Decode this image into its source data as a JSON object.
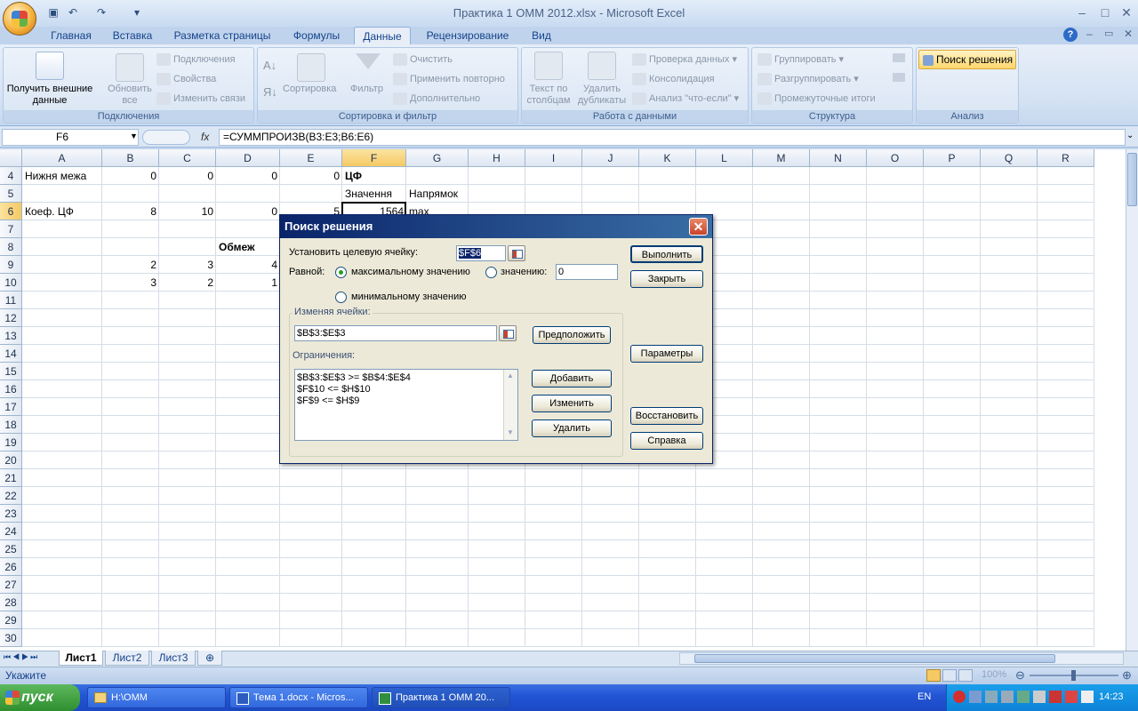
{
  "window": {
    "title": "Практика 1 ОММ 2012.xlsx - Microsoft Excel",
    "controls": {
      "minimize": "–",
      "maximize": "□",
      "close": "✕"
    }
  },
  "ribbon_tabs": [
    "Главная",
    "Вставка",
    "Разметка страницы",
    "Формулы",
    "Данные",
    "Рецензирование",
    "Вид"
  ],
  "active_tab": "Данные",
  "ribbon": {
    "connections_group": {
      "label": "Подключения",
      "get_external_data": "Получить внешние данные",
      "refresh_all": "Обновить все",
      "connections": "Подключения",
      "properties": "Свойства",
      "edit_links": "Изменить связи"
    },
    "sort_filter_group": {
      "label": "Сортировка и фильтр",
      "sort": "Сортировка",
      "filter": "Фильтр",
      "clear": "Очистить",
      "reapply": "Применить повторно",
      "advanced": "Дополнительно"
    },
    "data_tools_group": {
      "label": "Работа с данными",
      "text_to_columns": "Текст по столбцам",
      "remove_duplicates": "Удалить дубликаты",
      "data_validation": "Проверка данных",
      "consolidate": "Консолидация",
      "what_if": "Анализ \"что-если\""
    },
    "outline_group": {
      "label": "Структура",
      "group": "Группировать",
      "ungroup": "Разгруппировать",
      "subtotal": "Промежуточные итоги"
    },
    "analysis_group": {
      "label": "Анализ",
      "solver": "Поиск решения"
    }
  },
  "formula_bar": {
    "name_box": "F6",
    "fx": "fx",
    "formula": "=СУММПРОИЗВ(B3:E3;B6:E6)"
  },
  "columns": [
    "A",
    "B",
    "C",
    "D",
    "E",
    "F",
    "G",
    "H",
    "I",
    "J",
    "K",
    "L",
    "M",
    "N",
    "O",
    "P",
    "Q",
    "R"
  ],
  "rows": [
    "4",
    "5",
    "6",
    "7",
    "8",
    "9",
    "10",
    "11",
    "12",
    "13",
    "14",
    "15",
    "16",
    "17",
    "18",
    "19",
    "20",
    "21",
    "22",
    "23",
    "24",
    "25",
    "26",
    "27",
    "28",
    "29",
    "30"
  ],
  "cells": {
    "A4": "Нижня межа",
    "B4": "0",
    "C4": "0",
    "D4": "0",
    "E4": "0",
    "F4": "ЦФ",
    "F5": "Значення",
    "G5": "Напрямок",
    "A6": "Коеф. ЦФ",
    "B6": "8",
    "C6": "10",
    "D6": "0",
    "E6": "5",
    "F6": "1564",
    "G6": "max",
    "D8": "Обмеж",
    "B9": "2",
    "C9": "3",
    "D9": "4",
    "B10": "3",
    "C10": "2",
    "D10": "1"
  },
  "sheets": [
    "Лист1",
    "Лист2",
    "Лист3"
  ],
  "active_sheet": "Лист1",
  "status": {
    "mode": "Укажите",
    "zoom": "100%"
  },
  "solver_dialog": {
    "title": "Поиск решения",
    "target_label": "Установить целевую ячейку:",
    "target_value": "$F$6",
    "equal_label": "Равной:",
    "max_label": "максимальному значению",
    "value_label": "значению:",
    "value_input": "0",
    "min_label": "минимальному значению",
    "selected_option": "max",
    "changing_label": "Изменяя ячейки:",
    "changing_value": "$B$3:$E$3",
    "guess_button": "Предположить",
    "constraints_label": "Ограничения:",
    "constraints": [
      "$B$3:$E$3 >= $B$4:$E$4",
      "$F$10 <= $H$10",
      "$F$9 <= $H$9"
    ],
    "add_button": "Добавить",
    "change_button": "Изменить",
    "delete_button": "Удалить",
    "solve_button": "Выполнить",
    "close_button": "Закрыть",
    "options_button": "Параметры",
    "reset_button": "Восстановить",
    "help_button": "Справка"
  },
  "taskbar": {
    "start": "пуск",
    "tasks": [
      "H:\\ОММ",
      "Тема 1.docx - Micros...",
      "Практика 1 ОММ 20..."
    ],
    "lang": "EN",
    "clock": "14:23"
  }
}
